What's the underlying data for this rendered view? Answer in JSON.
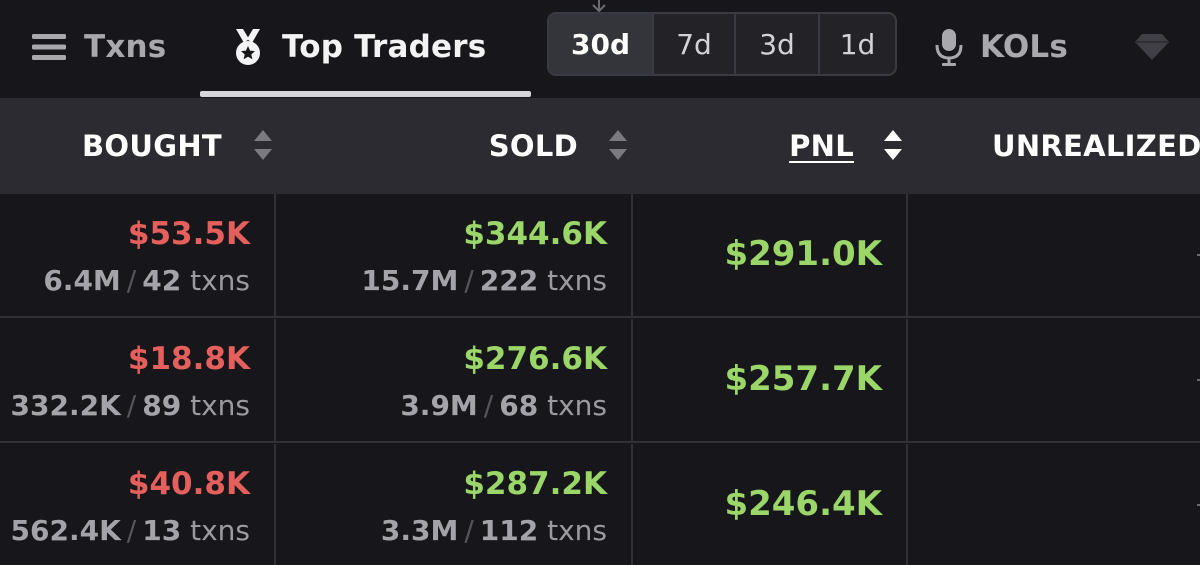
{
  "tabs": [
    {
      "label": "Txns",
      "icon": "list-icon",
      "active": false
    },
    {
      "label": "Top Traders",
      "icon": "medal-icon",
      "active": true
    },
    {
      "label": "KOLs",
      "icon": "microphone-icon",
      "active": false
    }
  ],
  "period_filter": {
    "options": [
      "30d",
      "7d",
      "3d",
      "1d"
    ],
    "selected": "30d"
  },
  "table": {
    "columns": [
      {
        "label": "BOUGHT",
        "sortable": true
      },
      {
        "label": "SOLD",
        "sortable": true
      },
      {
        "label": "PNL",
        "sortable": true,
        "active_sort": true
      },
      {
        "label": "UNREALIZED",
        "sortable": false
      }
    ],
    "rows": [
      {
        "bought": {
          "usd": "$53.5K",
          "tokens": "6.4M",
          "txns": "42",
          "txns_suffix": "txns"
        },
        "sold": {
          "usd": "$344.6K",
          "tokens": "15.7M",
          "txns": "222",
          "txns_suffix": "txns"
        },
        "pnl": "$291.0K",
        "unrealized": ""
      },
      {
        "bought": {
          "usd": "$18.8K",
          "tokens": "332.2K",
          "txns": "89",
          "txns_suffix": "txns"
        },
        "sold": {
          "usd": "$276.6K",
          "tokens": "3.9M",
          "txns": "68",
          "txns_suffix": "txns"
        },
        "pnl": "$257.7K",
        "unrealized": ""
      },
      {
        "bought": {
          "usd": "$40.8K",
          "tokens": "562.4K",
          "txns": "13",
          "txns_suffix": "txns"
        },
        "sold": {
          "usd": "$287.2K",
          "tokens": "3.3M",
          "txns": "112",
          "txns_suffix": "txns"
        },
        "pnl": "$246.4K",
        "unrealized": ""
      }
    ]
  },
  "colors": {
    "background": "#17171b",
    "header_bg": "#2b2b31",
    "negative": "#e5605c",
    "positive": "#9bd668",
    "muted": "#9a9aa0"
  }
}
